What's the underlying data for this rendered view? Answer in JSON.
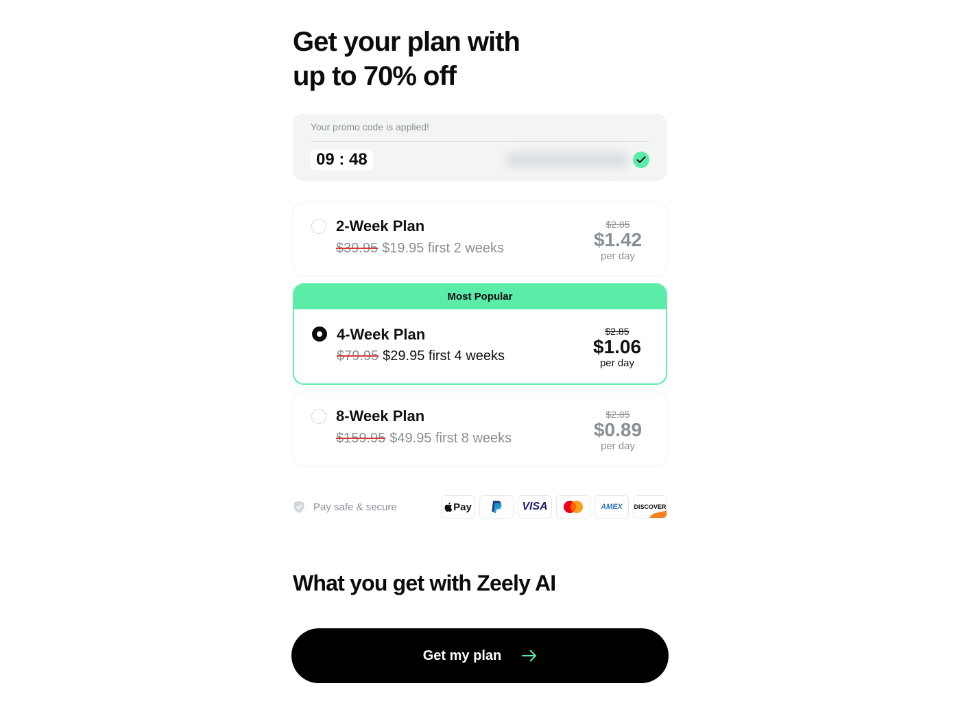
{
  "header": {
    "title_line1": "Get your plan with",
    "title_line2": "up to 70% off"
  },
  "promo": {
    "label": "Your promo code is applied!",
    "timer": "09 : 48"
  },
  "plans": [
    {
      "name": "2-Week Plan",
      "old_price": "$39.95",
      "price_text": "$19.95 first 2 weeks",
      "per_day_old": "$2.85",
      "per_day": "$1.42",
      "per_day_unit": "per day",
      "selected": false
    },
    {
      "badge": "Most Popular",
      "name": "4-Week Plan",
      "old_price": "$79.95",
      "price_text": "$29.95 first 4 weeks",
      "per_day_old": "$2.85",
      "per_day": "$1.06",
      "per_day_unit": "per day",
      "selected": true
    },
    {
      "name": "8-Week Plan",
      "old_price": "$159.95",
      "price_text": "$49.95 first 8 weeks",
      "per_day_old": "$2.85",
      "per_day": "$0.89",
      "per_day_unit": "per day",
      "selected": false
    }
  ],
  "secure": {
    "text": "Pay safe & secure",
    "icon": "shield-icon"
  },
  "payment_methods": {
    "applepay": "Pay",
    "visa": "VISA",
    "amex": "AMEX",
    "discover": "DISCOVER"
  },
  "section": {
    "title": "What you get with Zeely AI"
  },
  "cta": {
    "label": "Get my plan",
    "icon": "arrow-right-icon"
  },
  "colors": {
    "accent": "#5cecaa",
    "muted": "#8a8f96",
    "strike": "#d43a3a",
    "cta_bg": "#000000"
  }
}
